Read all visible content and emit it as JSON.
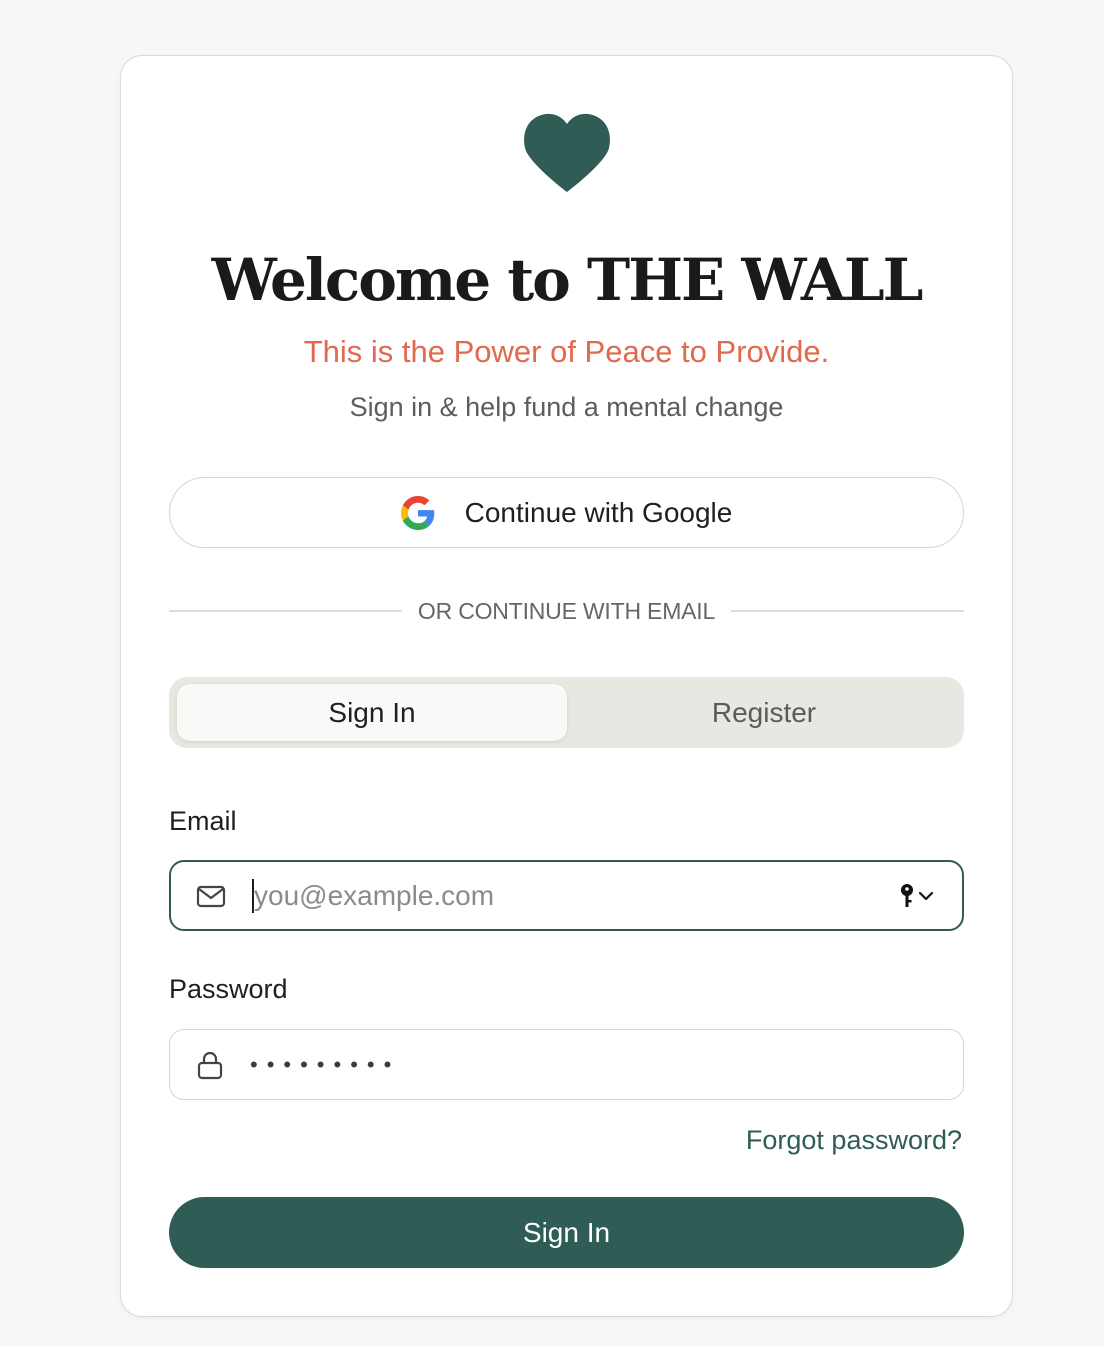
{
  "colors": {
    "brand": "#2f5d55",
    "accent": "#e0694e",
    "background": "#f8f7f5"
  },
  "logo": {
    "icon": "heart-icon"
  },
  "header": {
    "title": "Welcome to THE WALL",
    "tagline": "This is the Power of Peace to Provide.",
    "subtitle": "Sign in & help fund a mental change"
  },
  "google": {
    "icon": "google-icon",
    "label": "Continue with Google"
  },
  "divider": {
    "text": "OR CONTINUE WITH EMAIL"
  },
  "tabs": {
    "items": [
      {
        "label": "Sign In",
        "active": true
      },
      {
        "label": "Register",
        "active": false
      }
    ]
  },
  "form": {
    "email": {
      "label": "Email",
      "placeholder": "you@example.com",
      "value": "",
      "icon": "mail-icon"
    },
    "password": {
      "label": "Password",
      "masked_value": "•••••••••",
      "icon": "lock-icon"
    },
    "password_manager": {
      "icon": "key-icon"
    },
    "forgot_label": "Forgot password?",
    "submit_label": "Sign In"
  }
}
